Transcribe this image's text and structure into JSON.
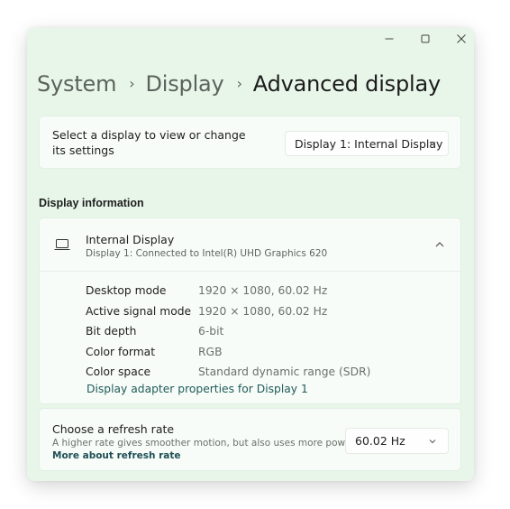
{
  "window": {
    "controls": {
      "minimize": "minimize-icon",
      "maximize": "maximize-icon",
      "close": "close-icon"
    }
  },
  "breadcrumb": {
    "items": [
      "System",
      "Display"
    ],
    "separator": "›",
    "current": "Advanced display"
  },
  "display_selector": {
    "label": "Select a display to view or change its settings",
    "selected": "Display 1: Internal Display",
    "icon": "chevron-down-icon"
  },
  "display_information": {
    "section_title": "Display information",
    "header": {
      "icon": "laptop-icon",
      "title": "Internal Display",
      "subtitle": "Display 1: Connected to Intel(R) UHD Graphics 620",
      "toggle_icon": "chevron-up-icon"
    },
    "rows": [
      {
        "label": "Desktop mode",
        "value": "1920 × 1080, 60.02 Hz"
      },
      {
        "label": "Active signal mode",
        "value": "1920 × 1080, 60.02 Hz"
      },
      {
        "label": "Bit depth",
        "value": "6-bit"
      },
      {
        "label": "Color format",
        "value": "RGB"
      },
      {
        "label": "Color space",
        "value": "Standard dynamic range (SDR)"
      }
    ],
    "link": "Display adapter properties for Display 1"
  },
  "refresh_rate": {
    "title": "Choose a refresh rate",
    "description": "A higher rate gives smoother motion, but also uses more power",
    "link": "More about refresh rate",
    "selected": "60.02 Hz",
    "icon": "chevron-down-icon"
  },
  "colors": {
    "window_bg": "#e8f6e9",
    "card_bg": "#f7fcf8",
    "link": "#1f5b5a"
  }
}
